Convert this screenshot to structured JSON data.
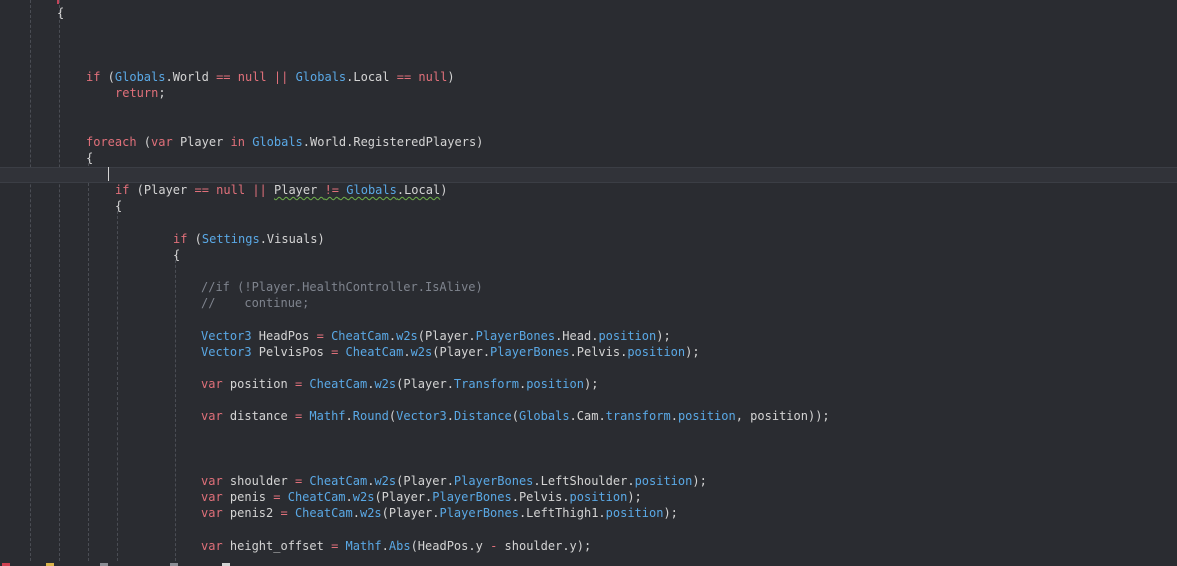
{
  "editor": {
    "language": "C#",
    "colors": {
      "background": "#2a2c31",
      "keyword": "#e0707a",
      "type": "#5aa9e6",
      "comment": "#7f848e",
      "text": "#d4d4d4",
      "squiggle": "#6fb14a"
    },
    "lines": [
      {
        "segments": [
          {
            "t": "{",
            "c": "punc"
          }
        ]
      },
      {
        "segments": [
          {
            "t": "if",
            "c": "kw"
          },
          {
            "t": " (",
            "c": "punc"
          },
          {
            "t": "Globals",
            "c": "typ"
          },
          {
            "t": ".World ",
            "c": "punc"
          },
          {
            "t": "==",
            "c": "kw"
          },
          {
            "t": " ",
            "c": "punc"
          },
          {
            "t": "null",
            "c": "kw"
          },
          {
            "t": " ",
            "c": "punc"
          },
          {
            "t": "||",
            "c": "kw"
          },
          {
            "t": " ",
            "c": "punc"
          },
          {
            "t": "Globals",
            "c": "typ"
          },
          {
            "t": ".Local ",
            "c": "punc"
          },
          {
            "t": "==",
            "c": "kw"
          },
          {
            "t": " ",
            "c": "punc"
          },
          {
            "t": "null",
            "c": "kw"
          },
          {
            "t": ")",
            "c": "punc"
          }
        ]
      },
      {
        "segments": [
          {
            "t": "return",
            "c": "kw"
          },
          {
            "t": ";",
            "c": "punc"
          }
        ]
      },
      {
        "segments": [
          {
            "t": "foreach",
            "c": "kw"
          },
          {
            "t": " (",
            "c": "punc"
          },
          {
            "t": "var",
            "c": "kw"
          },
          {
            "t": " Player ",
            "c": "punc"
          },
          {
            "t": "in",
            "c": "kw"
          },
          {
            "t": " ",
            "c": "punc"
          },
          {
            "t": "Globals",
            "c": "typ"
          },
          {
            "t": ".World.RegisteredPlayers)",
            "c": "punc"
          }
        ]
      },
      {
        "segments": [
          {
            "t": "{",
            "c": "punc"
          }
        ]
      },
      {
        "segments": [
          {
            "t": "if",
            "c": "kw"
          },
          {
            "t": " (Player ",
            "c": "punc"
          },
          {
            "t": "==",
            "c": "kw"
          },
          {
            "t": " ",
            "c": "punc"
          },
          {
            "t": "null",
            "c": "kw"
          },
          {
            "t": " ",
            "c": "punc"
          },
          {
            "t": "||",
            "c": "kw"
          },
          {
            "t": " ",
            "c": "punc"
          },
          {
            "t": "Player ",
            "c": "punc squig"
          },
          {
            "t": "!=",
            "c": "kw squig"
          },
          {
            "t": " ",
            "c": "punc squig"
          },
          {
            "t": "Globals",
            "c": "typ squig"
          },
          {
            "t": ".Local",
            "c": "punc squig"
          },
          {
            "t": ")",
            "c": "punc"
          }
        ]
      },
      {
        "segments": [
          {
            "t": "{",
            "c": "punc"
          }
        ]
      },
      {
        "segments": [
          {
            "t": "if",
            "c": "kw"
          },
          {
            "t": " (",
            "c": "punc"
          },
          {
            "t": "Settings",
            "c": "typ"
          },
          {
            "t": ".Visuals)",
            "c": "punc"
          }
        ]
      },
      {
        "segments": [
          {
            "t": "{",
            "c": "punc"
          }
        ]
      },
      {
        "segments": [
          {
            "t": "//if (!Player.HealthController.IsAlive)",
            "c": "cmt"
          }
        ]
      },
      {
        "segments": [
          {
            "t": "//    continue;",
            "c": "cmt"
          }
        ]
      },
      {
        "segments": [
          {
            "t": "Vector3",
            "c": "typ"
          },
          {
            "t": " HeadPos ",
            "c": "punc"
          },
          {
            "t": "=",
            "c": "kw"
          },
          {
            "t": " ",
            "c": "punc"
          },
          {
            "t": "CheatCam",
            "c": "typ"
          },
          {
            "t": ".",
            "c": "punc"
          },
          {
            "t": "w2s",
            "c": "typ"
          },
          {
            "t": "(Player.",
            "c": "punc"
          },
          {
            "t": "PlayerBones",
            "c": "typ"
          },
          {
            "t": ".Head.",
            "c": "punc"
          },
          {
            "t": "position",
            "c": "typ"
          },
          {
            "t": ");",
            "c": "punc"
          }
        ]
      },
      {
        "segments": [
          {
            "t": "Vector3",
            "c": "typ"
          },
          {
            "t": " PelvisPos ",
            "c": "punc"
          },
          {
            "t": "=",
            "c": "kw"
          },
          {
            "t": " ",
            "c": "punc"
          },
          {
            "t": "CheatCam",
            "c": "typ"
          },
          {
            "t": ".",
            "c": "punc"
          },
          {
            "t": "w2s",
            "c": "typ"
          },
          {
            "t": "(Player.",
            "c": "punc"
          },
          {
            "t": "PlayerBones",
            "c": "typ"
          },
          {
            "t": ".Pelvis.",
            "c": "punc"
          },
          {
            "t": "position",
            "c": "typ"
          },
          {
            "t": ");",
            "c": "punc"
          }
        ]
      },
      {
        "segments": [
          {
            "t": "var",
            "c": "kw"
          },
          {
            "t": " position ",
            "c": "punc"
          },
          {
            "t": "=",
            "c": "kw"
          },
          {
            "t": " ",
            "c": "punc"
          },
          {
            "t": "CheatCam",
            "c": "typ"
          },
          {
            "t": ".",
            "c": "punc"
          },
          {
            "t": "w2s",
            "c": "typ"
          },
          {
            "t": "(Player.",
            "c": "punc"
          },
          {
            "t": "Transform",
            "c": "typ"
          },
          {
            "t": ".",
            "c": "punc"
          },
          {
            "t": "position",
            "c": "typ"
          },
          {
            "t": ");",
            "c": "punc"
          }
        ]
      },
      {
        "segments": [
          {
            "t": "var",
            "c": "kw"
          },
          {
            "t": " distance ",
            "c": "punc"
          },
          {
            "t": "=",
            "c": "kw"
          },
          {
            "t": " ",
            "c": "punc"
          },
          {
            "t": "Mathf",
            "c": "typ"
          },
          {
            "t": ".",
            "c": "punc"
          },
          {
            "t": "Round",
            "c": "typ"
          },
          {
            "t": "(",
            "c": "punc"
          },
          {
            "t": "Vector3",
            "c": "typ"
          },
          {
            "t": ".",
            "c": "punc"
          },
          {
            "t": "Distance",
            "c": "typ"
          },
          {
            "t": "(",
            "c": "punc"
          },
          {
            "t": "Globals",
            "c": "typ"
          },
          {
            "t": ".Cam.",
            "c": "punc"
          },
          {
            "t": "transform",
            "c": "typ"
          },
          {
            "t": ".",
            "c": "punc"
          },
          {
            "t": "position",
            "c": "typ"
          },
          {
            "t": ", position));",
            "c": "punc"
          }
        ]
      },
      {
        "segments": [
          {
            "t": "var",
            "c": "kw"
          },
          {
            "t": " shoulder ",
            "c": "punc"
          },
          {
            "t": "=",
            "c": "kw"
          },
          {
            "t": " ",
            "c": "punc"
          },
          {
            "t": "CheatCam",
            "c": "typ"
          },
          {
            "t": ".",
            "c": "punc"
          },
          {
            "t": "w2s",
            "c": "typ"
          },
          {
            "t": "(Player.",
            "c": "punc"
          },
          {
            "t": "PlayerBones",
            "c": "typ"
          },
          {
            "t": ".LeftShoulder.",
            "c": "punc"
          },
          {
            "t": "position",
            "c": "typ"
          },
          {
            "t": ");",
            "c": "punc"
          }
        ]
      },
      {
        "segments": [
          {
            "t": "var",
            "c": "kw"
          },
          {
            "t": " penis ",
            "c": "punc"
          },
          {
            "t": "=",
            "c": "kw"
          },
          {
            "t": " ",
            "c": "punc"
          },
          {
            "t": "CheatCam",
            "c": "typ"
          },
          {
            "t": ".",
            "c": "punc"
          },
          {
            "t": "w2s",
            "c": "typ"
          },
          {
            "t": "(Player.",
            "c": "punc"
          },
          {
            "t": "PlayerBones",
            "c": "typ"
          },
          {
            "t": ".Pelvis.",
            "c": "punc"
          },
          {
            "t": "position",
            "c": "typ"
          },
          {
            "t": ");",
            "c": "punc"
          }
        ]
      },
      {
        "segments": [
          {
            "t": "var",
            "c": "kw"
          },
          {
            "t": " penis2 ",
            "c": "punc"
          },
          {
            "t": "=",
            "c": "kw"
          },
          {
            "t": " ",
            "c": "punc"
          },
          {
            "t": "CheatCam",
            "c": "typ"
          },
          {
            "t": ".",
            "c": "punc"
          },
          {
            "t": "w2s",
            "c": "typ"
          },
          {
            "t": "(Player.",
            "c": "punc"
          },
          {
            "t": "PlayerBones",
            "c": "typ"
          },
          {
            "t": ".LeftThigh1.",
            "c": "punc"
          },
          {
            "t": "position",
            "c": "typ"
          },
          {
            "t": ");",
            "c": "punc"
          }
        ]
      },
      {
        "segments": [
          {
            "t": "var",
            "c": "kw"
          },
          {
            "t": " height_offset ",
            "c": "punc"
          },
          {
            "t": "=",
            "c": "kw"
          },
          {
            "t": " ",
            "c": "punc"
          },
          {
            "t": "Mathf",
            "c": "typ"
          },
          {
            "t": ".",
            "c": "punc"
          },
          {
            "t": "Abs",
            "c": "typ"
          },
          {
            "t": "(HeadPos.y ",
            "c": "punc"
          },
          {
            "t": "-",
            "c": "kw"
          },
          {
            "t": " shoulder.y);",
            "c": "punc"
          }
        ]
      }
    ]
  }
}
